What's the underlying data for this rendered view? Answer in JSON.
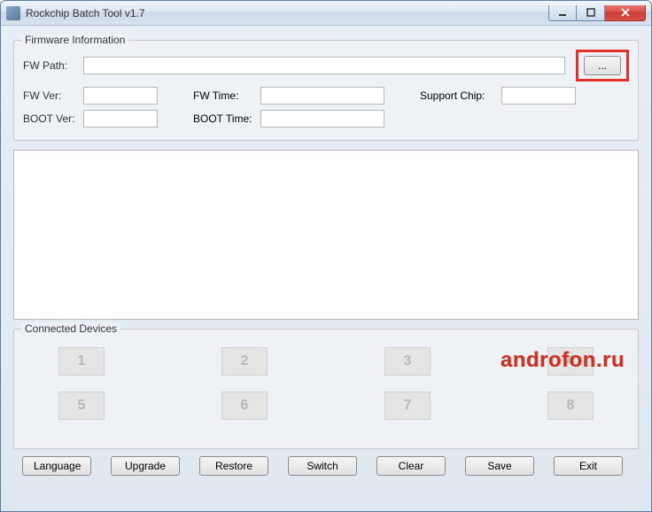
{
  "window": {
    "title": "Rockchip Batch Tool v1.7"
  },
  "firmware": {
    "legend": "Firmware Information",
    "fw_path_label": "FW Path:",
    "fw_path_value": "",
    "browse_label": "...",
    "fw_ver_label": "FW Ver:",
    "fw_ver_value": "",
    "fw_time_label": "FW Time:",
    "fw_time_value": "",
    "support_chip_label": "Support Chip:",
    "support_chip_value": "",
    "boot_ver_label": "BOOT Ver:",
    "boot_ver_value": "",
    "boot_time_label": "BOOT Time:",
    "boot_time_value": ""
  },
  "devices": {
    "legend": "Connected Devices",
    "slots": [
      "1",
      "2",
      "3",
      "4",
      "5",
      "6",
      "7",
      "8"
    ]
  },
  "buttons": {
    "language": "Language",
    "upgrade": "Upgrade",
    "restore": "Restore",
    "switch": "Switch",
    "clear": "Clear",
    "save": "Save",
    "exit": "Exit"
  },
  "watermark": "androfon.ru",
  "colors": {
    "highlight": "#e03028",
    "titlebar_close": "#d64d46"
  }
}
